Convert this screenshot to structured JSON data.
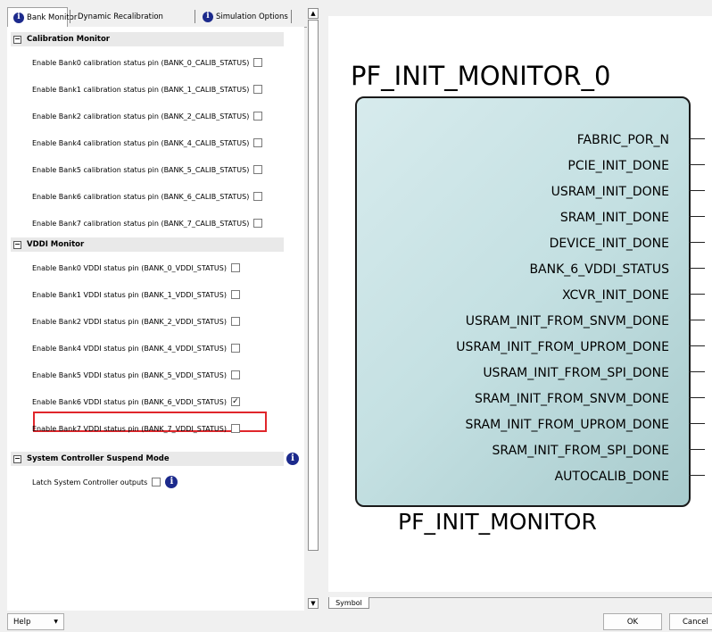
{
  "tabs": [
    {
      "label": "Bank Monitor"
    },
    {
      "label": "Dynamic Recalibration"
    },
    {
      "label": "Simulation Options"
    }
  ],
  "sections": {
    "calibration": {
      "title": "Calibration Monitor",
      "items": [
        {
          "label": "Enable Bank0 calibration status pin (BANK_0_CALIB_STATUS)",
          "checked": false
        },
        {
          "label": "Enable Bank1 calibration status pin (BANK_1_CALIB_STATUS)",
          "checked": false
        },
        {
          "label": "Enable Bank2 calibration status pin (BANK_2_CALIB_STATUS)",
          "checked": false
        },
        {
          "label": "Enable Bank4 calibration status pin (BANK_4_CALIB_STATUS)",
          "checked": false
        },
        {
          "label": "Enable Bank5 calibration status pin (BANK_5_CALIB_STATUS)",
          "checked": false
        },
        {
          "label": "Enable Bank6 calibration status pin (BANK_6_CALIB_STATUS)",
          "checked": false
        },
        {
          "label": "Enable Bank7 calibration status pin (BANK_7_CALIB_STATUS)",
          "checked": false
        }
      ]
    },
    "vddi": {
      "title": "VDDI Monitor",
      "items": [
        {
          "label": "Enable Bank0 VDDI status pin (BANK_0_VDDI_STATUS)",
          "checked": false
        },
        {
          "label": "Enable Bank1 VDDI status pin (BANK_1_VDDI_STATUS)",
          "checked": false
        },
        {
          "label": "Enable Bank2 VDDI status pin (BANK_2_VDDI_STATUS)",
          "checked": false
        },
        {
          "label": "Enable Bank4 VDDI status pin (BANK_4_VDDI_STATUS)",
          "checked": false
        },
        {
          "label": "Enable Bank5 VDDI status pin (BANK_5_VDDI_STATUS)",
          "checked": false
        },
        {
          "label": "Enable Bank6 VDDI status pin (BANK_6_VDDI_STATUS)",
          "checked": true
        },
        {
          "label": "Enable Bank7 VDDI status pin (BANK_7_VDDI_STATUS)",
          "checked": false
        }
      ]
    },
    "suspend": {
      "title": "System Controller Suspend Mode",
      "items": [
        {
          "label": "Latch System Controller outputs",
          "checked": false
        }
      ]
    }
  },
  "symbol": {
    "instance_name": "PF_INIT_MONITOR_0",
    "component_name": "PF_INIT_MONITOR",
    "ports": [
      "FABRIC_POR_N",
      "PCIE_INIT_DONE",
      "USRAM_INIT_DONE",
      "SRAM_INIT_DONE",
      "DEVICE_INIT_DONE",
      "BANK_6_VDDI_STATUS",
      "XCVR_INIT_DONE",
      "USRAM_INIT_FROM_SNVM_DONE",
      "USRAM_INIT_FROM_UPROM_DONE",
      "USRAM_INIT_FROM_SPI_DONE",
      "SRAM_INIT_FROM_SNVM_DONE",
      "SRAM_INIT_FROM_UPROM_DONE",
      "SRAM_INIT_FROM_SPI_DONE",
      "AUTOCALIB_DONE"
    ],
    "tab_label": "Symbol"
  },
  "footer": {
    "help_label": "Help",
    "ok_label": "OK",
    "cancel_label": "Cancel"
  },
  "icons": {
    "info": "info-circle-icon",
    "collapse": "minus-box-icon",
    "checkbox_checked": "checkmark-icon"
  },
  "colors": {
    "highlight": "#e0262b",
    "info_icon": "#1c2a8c",
    "block_fill": "#c4e0e2"
  }
}
